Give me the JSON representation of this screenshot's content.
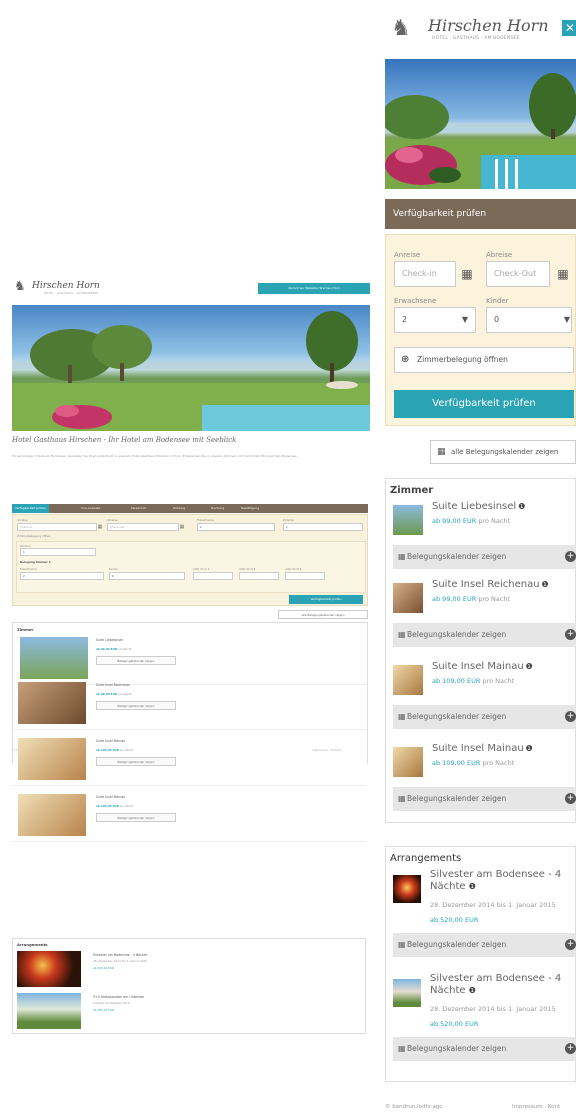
{
  "brand": {
    "name": "Hirschen Horn",
    "tagline": "HOTEL · GASTHAUS · AM BODENSEE"
  },
  "desktop": {
    "top_button": "Zurück zur Website Hirschen Horn",
    "title": "Hotel Gasthaus Hirschen - Ihr Hotel am Bodensee mit Seeblick",
    "intro": "Ein einmaliger Urlaub am Bodensee: Genießen Sie Ihren Aufenthalt in unserem Hotel Gasthaus Hirschen in Horn. Entspannen Sie in unseren Zimmern mit herrlichem Blick auf den Bodensee.",
    "tabs": [
      "Verfügbarkeit prüfen",
      "Ihre Auswahl",
      "Persönlich",
      "Zahlung",
      "Buchung",
      "Bestätigung"
    ],
    "form": {
      "arrival_label": "Anreise",
      "arrival_placeholder": "Check-in",
      "departure_label": "Abreise",
      "departure_placeholder": "Check-out",
      "adults_label": "Erwachsene",
      "adults_value": "2",
      "rooms_label": "Zimmer",
      "rooms_value": "1",
      "occupancy_toggle": "Zimmerbelegung öffnen",
      "room_label": "Zimmer",
      "room_value": "1",
      "room_occupancy_label": "Belegung Zimmer 1",
      "adults2_label": "Erwachsene",
      "adults2_value": "2",
      "children_label": "Kinder",
      "children_value": "0",
      "child1_label": "Alter Kind 1",
      "child2_label": "Alter Kind 2",
      "child3_label": "Alter Kind 3",
      "check_button": "Verfügbarkeit prüfen"
    },
    "calendar_button": "Alle Belegungskalender zeigen",
    "rooms_heading": "Zimmer",
    "rooms": [
      {
        "name": "Suite Liebesinsel",
        "price": "ab 99,00 EUR",
        "per": "pro Nacht",
        "button": "Belegungskalender zeigen"
      },
      {
        "name": "Suite Insel Reichenau",
        "price": "ab 99,00 EUR",
        "per": "pro Nacht",
        "button": "Belegungskalender zeigen"
      },
      {
        "name": "Suite Insel Mainau",
        "price": "ab 109,00 EUR",
        "per": "pro Nacht",
        "button": "Belegungskalender zeigen"
      },
      {
        "name": "Suite Insel Mainau",
        "price": "ab 109,00 EUR",
        "per": "pro Nacht",
        "button": "Belegungskalender zeigen"
      }
    ],
    "arrangements_heading": "Arrangements",
    "arrangements": [
      {
        "name": "Silvester am Bodensee - 4 Nächte",
        "date": "28. Dezember 2014 bis 1. Januar 2015",
        "price": "ab 520,00 EUR"
      },
      {
        "name": "3+4 Herbstzauber am Untersee",
        "date": "buchbar bis Oktober 2014",
        "price": "ab 395,00 EUR"
      }
    ],
    "footer_left": "© Hirschen Horn",
    "footer_right": "Impressum · Kontakt"
  },
  "mobile": {
    "availability_bar": "Verfügbarkeit prüfen",
    "arrival_label": "Anreise",
    "arrival_placeholder": "Check-in",
    "departure_label": "Abreise",
    "departure_placeholder": "Check-Out",
    "adults_label": "Erwachsene",
    "adults_value": "2",
    "children_label": "Kinder",
    "children_value": "0",
    "occupancy_toggle": "Zimmerbelegung öffnen",
    "check_button": "Verfügbarkeit prüfen",
    "calendar_button": "alle Belegungskalender zeigen",
    "rooms_heading": "Zimmer",
    "rooms": [
      {
        "name": "Suite Liebesinsel",
        "price": "ab 99,00 EUR",
        "per": "pro Nacht",
        "button": "Belegungskalender zeigen"
      },
      {
        "name": "Suite Insel Reichenau",
        "price": "ab 99,00 EUR",
        "per": "pro Nacht",
        "button": "Belegungskalender zeigen"
      },
      {
        "name": "Suite Insel Mainau",
        "price": "ab 109,00 EUR",
        "per": "pro Nacht",
        "button": "Belegungskalender zeigen"
      },
      {
        "name": "Suite Insel Mainau",
        "price": "ab 109,00 EUR",
        "per": "pro Nacht",
        "button": "Belegungskalender zeigen"
      }
    ],
    "arrangements_heading": "Arrangements",
    "arrangements": [
      {
        "name": "Silvester am Bodensee - 4 Nächte",
        "date": "28. Dezember 2014 bis 1. Januar 2015",
        "price": "ab 520,00 EUR",
        "button": "Belegungskalender zeigen"
      },
      {
        "name": "Silvester am Bodensee - 4 Nächte",
        "date": "28. Dezember 2014 bis 1. Januar 2015",
        "price": "ab 520,00 EUR",
        "button": "Belegungskalender zeigen"
      }
    ],
    "footer_left": "© bandrun.lodhr.agc",
    "footer_right": "Impressum · Kont"
  },
  "colors": {
    "accent": "#2aa3b4",
    "bar": "#7b6a58",
    "form_bg": "#fbf3dc"
  }
}
